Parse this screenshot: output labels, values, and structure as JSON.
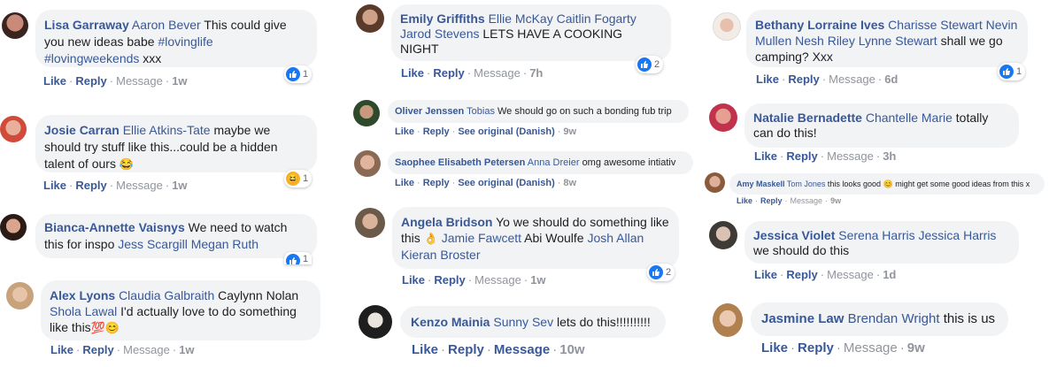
{
  "colors": {
    "link": "#385898",
    "bubble": "#f2f3f5",
    "meta": "#90949c",
    "like_blue": "#1877f2"
  },
  "icons": {
    "like": "thumbs-up-icon",
    "haha": "laughing-face-icon"
  },
  "comments": [
    {
      "author": "Lisa Garraway",
      "tags": "Aaron Bever",
      "text": "This could give you new ideas babe",
      "hashtags": "#lovinglife #lovingweekends",
      "tail": "xxx",
      "like": "Like",
      "reply": "Reply",
      "message": "Message",
      "time": "1w",
      "reaction_count": "1"
    },
    {
      "author": "Josie Carran",
      "tags": "Ellie Atkins-Tate",
      "text": "maybe we should try stuff like this...could be a hidden talent of ours",
      "emoji": "😂",
      "like": "Like",
      "reply": "Reply",
      "message": "Message",
      "time": "1w",
      "reaction_count": "1"
    },
    {
      "author": "Bianca-Annette Vaisnys",
      "text": "We need to watch this for inspo",
      "tags": "Jess Scargill Megan Ruth",
      "reaction_count": "1"
    },
    {
      "author": "Alex Lyons",
      "tags": "Claudia Galbraith",
      "text1": "Caylynn Nolan",
      "tags2": "Shola Lawal",
      "text": "I'd actually love to do something like this",
      "emoji": "💯😊",
      "like": "Like",
      "reply": "Reply",
      "message": "Message",
      "time": "1w"
    },
    {
      "author": "Emily Griffiths",
      "tags": "Ellie McKay Caitlin Fogarty Jarod Stevens",
      "text": "LETS HAVE A COOKING NIGHT",
      "like": "Like",
      "reply": "Reply",
      "message": "Message",
      "time": "7h",
      "reaction_count": "2"
    },
    {
      "author": "Oliver Jenssen",
      "tags": "Tobias",
      "text": "We should go on such a bonding fub trip",
      "like": "Like",
      "reply": "Reply",
      "see_original": "See original (Danish)",
      "time": "9w"
    },
    {
      "author": "Saophee Elisabeth Petersen",
      "tags": "Anna Dreier",
      "text": "omg awesome intiativ",
      "like": "Like",
      "reply": "Reply",
      "see_original": "See original (Danish)",
      "time": "8w"
    },
    {
      "author": "Angela Bridson",
      "text": "Yo we should do something like this",
      "emoji": "👌",
      "tags": "Jamie Fawcett",
      "text1": "Abi Woulfe",
      "tags2": "Josh Allan Kieran Broster",
      "like": "Like",
      "reply": "Reply",
      "message": "Message",
      "time": "1w",
      "reaction_count": "2"
    },
    {
      "author": "Kenzo Mainia",
      "tags": "Sunny Sev",
      "text": "lets do this!!!!!!!!!!",
      "like": "Like",
      "reply": "Reply",
      "message": "Message",
      "time": "10w"
    },
    {
      "author": "Bethany Lorraine Ives",
      "tags": "Charisse Stewart Nevin Mullen Nesh Riley Lynne Stewart",
      "text": "shall we go camping? Xxx",
      "like": "Like",
      "reply": "Reply",
      "message": "Message",
      "time": "6d",
      "reaction_count": "1"
    },
    {
      "author": "Natalie Bernadette",
      "tags": "Chantelle Marie",
      "text": "totally can do this!",
      "like": "Like",
      "reply": "Reply",
      "message": "Message",
      "time": "3h"
    },
    {
      "author": "Amy Maskell",
      "tags": "Tom Jones",
      "text": "this looks good",
      "emoji": "😊",
      "text2": "might get some good ideas from this x",
      "like": "Like",
      "reply": "Reply",
      "message": "Message",
      "time": "9w"
    },
    {
      "author": "Jessica Violet",
      "tags": "Serena Harris Jessica Harris",
      "text": "we should do this",
      "like": "Like",
      "reply": "Reply",
      "message": "Message",
      "time": "1d"
    },
    {
      "author": "Jasmine Law",
      "tags": "Brendan Wright",
      "text": "this is us",
      "like": "Like",
      "reply": "Reply",
      "message": "Message",
      "time": "9w"
    }
  ]
}
